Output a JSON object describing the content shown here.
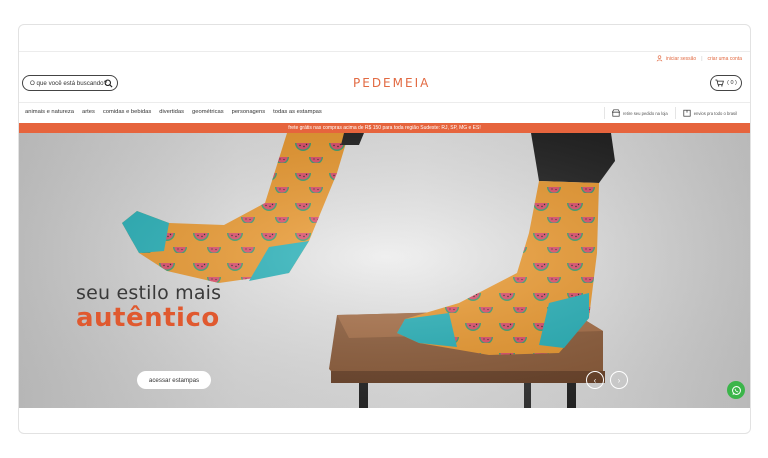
{
  "account": {
    "login_label": "iniciar sessão",
    "separator": "|",
    "signup_label": "criar uma conta"
  },
  "search": {
    "placeholder": "O que você está buscando?"
  },
  "brand": {
    "logo_text": "PEDEMEIA",
    "accent_color": "#e26a42"
  },
  "cart": {
    "count": "( 0 )"
  },
  "nav": {
    "items": [
      {
        "label": "animais e natureza"
      },
      {
        "label": "artes"
      },
      {
        "label": "comidas e bebidas"
      },
      {
        "label": "divertidas"
      },
      {
        "label": "geométricas"
      },
      {
        "label": "personagens"
      },
      {
        "label": "todas as estampas"
      }
    ],
    "store_pickup": "retire seu pedido na loja",
    "shipping": "envios pra todo o brasil"
  },
  "promo": {
    "text": "frete grátis nas compras acima de R$ 150 para toda região Sudeste: RJ, SP, MG e ES!",
    "color": "#e6643d"
  },
  "hero": {
    "headline_line1": "seu estilo mais",
    "headline_line2": "autêntico",
    "cta_label": "acessar estampas",
    "prev_icon": "chevron-left-icon",
    "next_icon": "chevron-right-icon"
  },
  "whatsapp": {
    "icon": "whatsapp-icon",
    "color": "#3bb54a"
  }
}
